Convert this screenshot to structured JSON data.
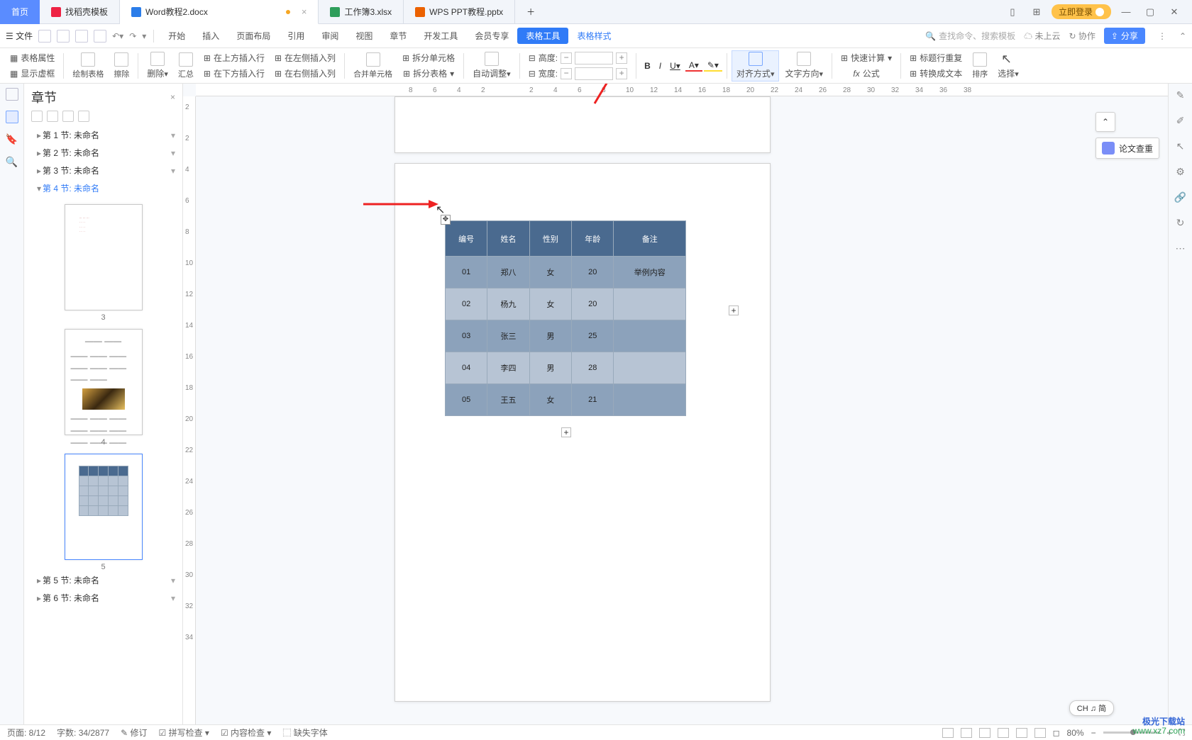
{
  "tabs": {
    "home": "首页",
    "t1": "找稻壳模板",
    "t2": "Word教程2.docx",
    "t3": "工作簿3.xlsx",
    "t4": "WPS PPT教程.pptx"
  },
  "win": {
    "login": "立即登录"
  },
  "menu": {
    "file": "文件",
    "items": [
      "开始",
      "插入",
      "页面布局",
      "引用",
      "审阅",
      "视图",
      "章节",
      "开发工具",
      "会员专享",
      "表格工具",
      "表格样式"
    ],
    "search_ph": "查找命令、搜索模板",
    "cloud": "未上云",
    "coop": "协作",
    "share": "分享"
  },
  "ribbon": {
    "r1a": "表格属性",
    "r1b": "显示虚框",
    "r2": "绘制表格",
    "r3": "擦除",
    "r4": "删除",
    "r5": "汇总",
    "r6a": "在上方插入行",
    "r6b": "在下方插入行",
    "r7a": "在左侧插入列",
    "r7b": "在右侧插入列",
    "r8": "合并单元格",
    "r9a": "拆分单元格",
    "r9b": "拆分表格",
    "r10": "自动调整",
    "r11a": "高度:",
    "r11b": "宽度:",
    "align": "对齐方式",
    "textdir": "文字方向",
    "fastcalc": "快速计算",
    "formula": "公式",
    "titlerow": "标题行重复",
    "totext": "转换成文本",
    "sort": "排序",
    "select": "选择"
  },
  "nav": {
    "title": "章节",
    "items": [
      "第 1 节: 未命名",
      "第 2 节: 未命名",
      "第 3 节: 未命名",
      "第 4 节: 未命名",
      "第 5 节: 未命名",
      "第 6 节: 未命名"
    ],
    "thumb_nums": [
      "3",
      "4",
      "5"
    ]
  },
  "float": {
    "check": "论文查重"
  },
  "table": {
    "headers": [
      "编号",
      "姓名",
      "性别",
      "年龄",
      "备注"
    ],
    "rows": [
      [
        "01",
        "郑八",
        "女",
        "20",
        "举例内容"
      ],
      [
        "02",
        "杨九",
        "女",
        "20",
        ""
      ],
      [
        "03",
        "张三",
        "男",
        "25",
        ""
      ],
      [
        "04",
        "李四",
        "男",
        "28",
        ""
      ],
      [
        "05",
        "王五",
        "女",
        "21",
        ""
      ]
    ]
  },
  "ruler_h": [
    "8",
    "6",
    "4",
    "2",
    "",
    "2",
    "4",
    "6",
    "8",
    "10",
    "12",
    "14",
    "16",
    "18",
    "20",
    "22",
    "24",
    "26",
    "28",
    "30",
    "32",
    "34",
    "36",
    "38"
  ],
  "ruler_v": [
    "2",
    "2",
    "4",
    "6",
    "8",
    "10",
    "12",
    "14",
    "16",
    "18",
    "20",
    "22",
    "24",
    "26",
    "28",
    "30",
    "32",
    "34"
  ],
  "status": {
    "page": "页面: 8/12",
    "words": "字数: 34/2877",
    "revise": "修订",
    "spell": "拼写检查",
    "content": "内容检查",
    "font": "缺失字体",
    "zoom": "80%"
  },
  "ime": "CH ♫ 简",
  "watermark1": "极光下载站",
  "watermark2": "www.xz7.com"
}
